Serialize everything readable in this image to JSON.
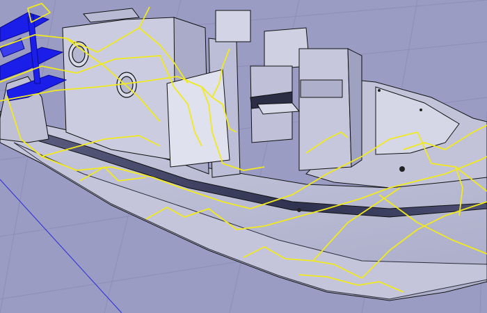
{
  "viewport": {
    "view": "perspective",
    "display_mode": "shaded",
    "colors": {
      "background": "#9a9cc4",
      "grid": "#8c8fba",
      "hull_light": "#d2d3e4",
      "hull_dark": "#3a3c58",
      "panel": "#c8c9dc",
      "edges": "#111111",
      "selection": "#f0ea1e",
      "highlight": "#1a1ee8",
      "world_axis": "#2a2ad8"
    }
  },
  "scene": {
    "objects": [
      {
        "name": "hull",
        "selected": false
      },
      {
        "name": "deck-frame",
        "selected": true
      },
      {
        "name": "cabin-bulkheads",
        "selected": false
      },
      {
        "name": "console",
        "selected": false
      },
      {
        "name": "bow-deck-structure",
        "selected": false,
        "highlighted": true
      },
      {
        "name": "internal-frames",
        "selected": true
      }
    ]
  }
}
